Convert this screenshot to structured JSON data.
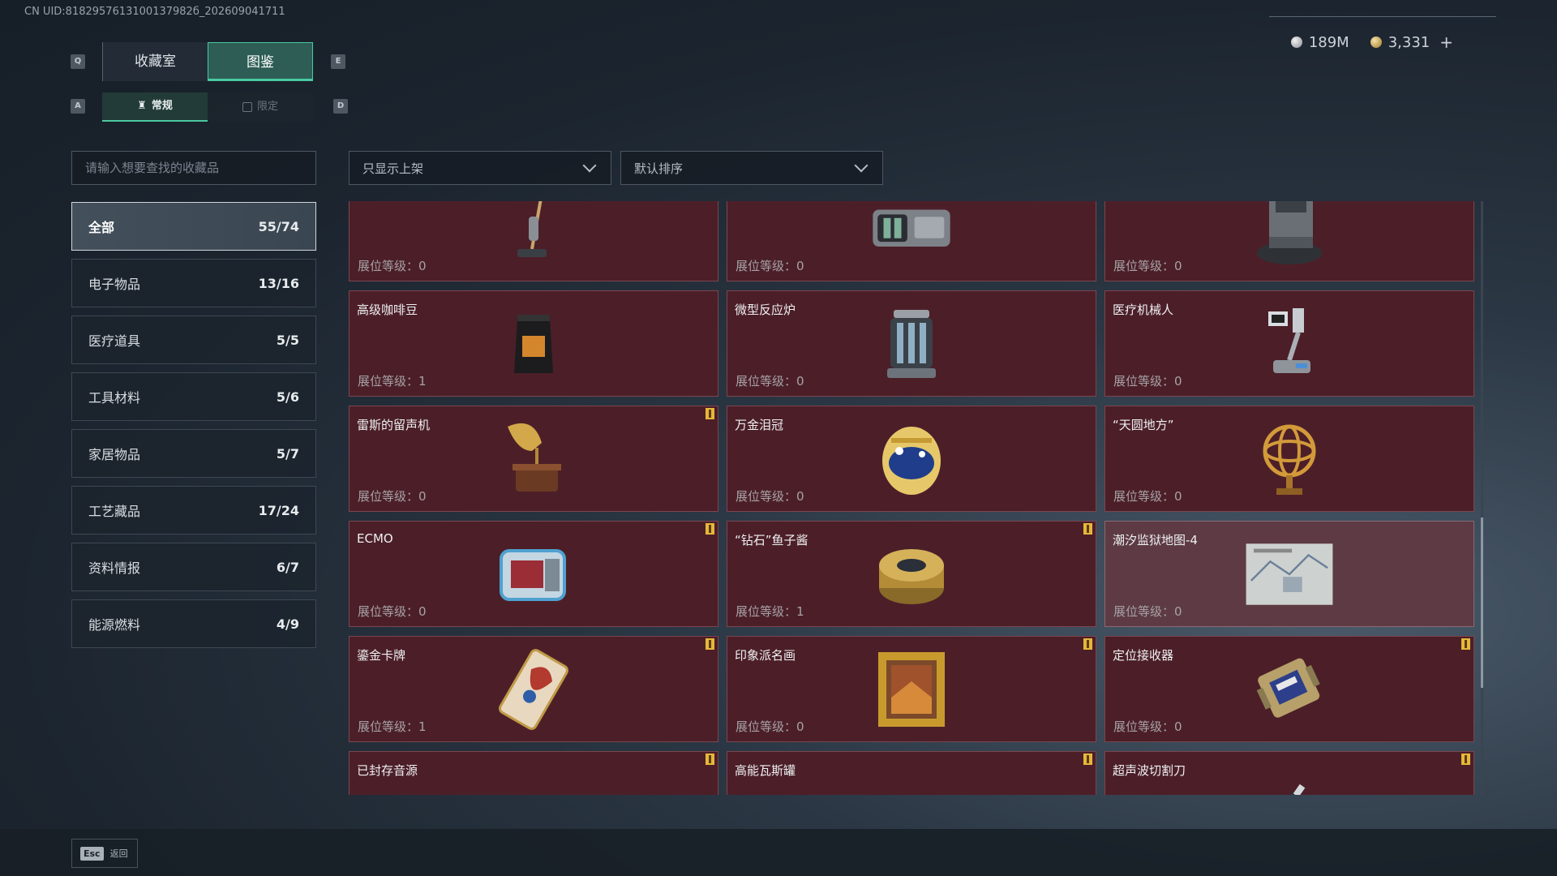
{
  "header": {
    "uid": "CN UID:8182957613100137982б_202609041711",
    "currency": {
      "silver": "189M",
      "gold": "3,331",
      "add": "+"
    }
  },
  "hotkeys": {
    "q": "Q",
    "e": "E",
    "a": "A",
    "d": "D"
  },
  "tabs_main": [
    {
      "label": "收藏室",
      "active": false
    },
    {
      "label": "图鉴",
      "active": true
    }
  ],
  "tabs_sub": [
    {
      "label": "常规",
      "active": true
    },
    {
      "label": "限定",
      "active": false
    }
  ],
  "search": {
    "placeholder": "请输入想要查找的收藏品"
  },
  "filters": {
    "shelf": "只显示上架",
    "sort": "默认排序"
  },
  "categories": [
    {
      "label": "全部",
      "count": "55/74",
      "active": true
    },
    {
      "label": "电子物品",
      "count": "13/16"
    },
    {
      "label": "医疗道具",
      "count": "5/5"
    },
    {
      "label": "工具材料",
      "count": "5/6"
    },
    {
      "label": "家居物品",
      "count": "5/7"
    },
    {
      "label": "工艺藏品",
      "count": "17/24"
    },
    {
      "label": "资料情报",
      "count": "6/7"
    },
    {
      "label": "能源燃料",
      "count": "4/9"
    }
  ],
  "level_label": "展位等级：",
  "items": [
    {
      "name": "",
      "level": "0",
      "icon": "vacuum-icon",
      "badge": false
    },
    {
      "name": "",
      "level": "0",
      "icon": "projector-icon",
      "badge": false
    },
    {
      "name": "",
      "level": "0",
      "icon": "robot-vacuum-icon",
      "badge": false
    },
    {
      "name": "高级咖啡豆",
      "level": "1",
      "icon": "coffee-bag-icon",
      "badge": false
    },
    {
      "name": "微型反应炉",
      "level": "0",
      "icon": "reactor-icon",
      "badge": false
    },
    {
      "name": "医疗机械人",
      "level": "0",
      "icon": "medical-robot-icon",
      "badge": false
    },
    {
      "name": "雷斯的留声机",
      "level": "0",
      "icon": "gramophone-icon",
      "badge": true
    },
    {
      "name": "万金泪冠",
      "level": "0",
      "icon": "jeweled-egg-icon",
      "badge": false
    },
    {
      "name": "“天圆地方”",
      "level": "0",
      "icon": "armillary-sphere-icon",
      "badge": false
    },
    {
      "name": "ECMO",
      "level": "0",
      "icon": "ecmo-machine-icon",
      "badge": true
    },
    {
      "name": "“钻石”鱼子酱",
      "level": "1",
      "icon": "caviar-tin-icon",
      "badge": true
    },
    {
      "name": "潮汐监狱地图-4",
      "level": "0",
      "icon": "map-icon",
      "badge": false,
      "alt": true
    },
    {
      "name": "鎏金卡牌",
      "level": "1",
      "icon": "gold-card-icon",
      "badge": true
    },
    {
      "name": "印象派名画",
      "level": "0",
      "icon": "painting-icon",
      "badge": true
    },
    {
      "name": "定位接收器",
      "level": "0",
      "icon": "receiver-icon",
      "badge": true
    },
    {
      "name": "已封存音源",
      "level": "",
      "icon": "sealed-audio-icon",
      "badge": true
    },
    {
      "name": "高能瓦斯罐",
      "level": "",
      "icon": "gas-canister-icon",
      "badge": true
    },
    {
      "name": "超声波切割刀",
      "level": "",
      "icon": "ultrasonic-cutter-icon",
      "badge": true
    }
  ],
  "footer": {
    "esc_key": "Esc",
    "esc_label": "返回"
  },
  "colors": {
    "accent": "#49c9a0",
    "card_bg": "#4c1f28",
    "badge": "#e6b73a"
  }
}
